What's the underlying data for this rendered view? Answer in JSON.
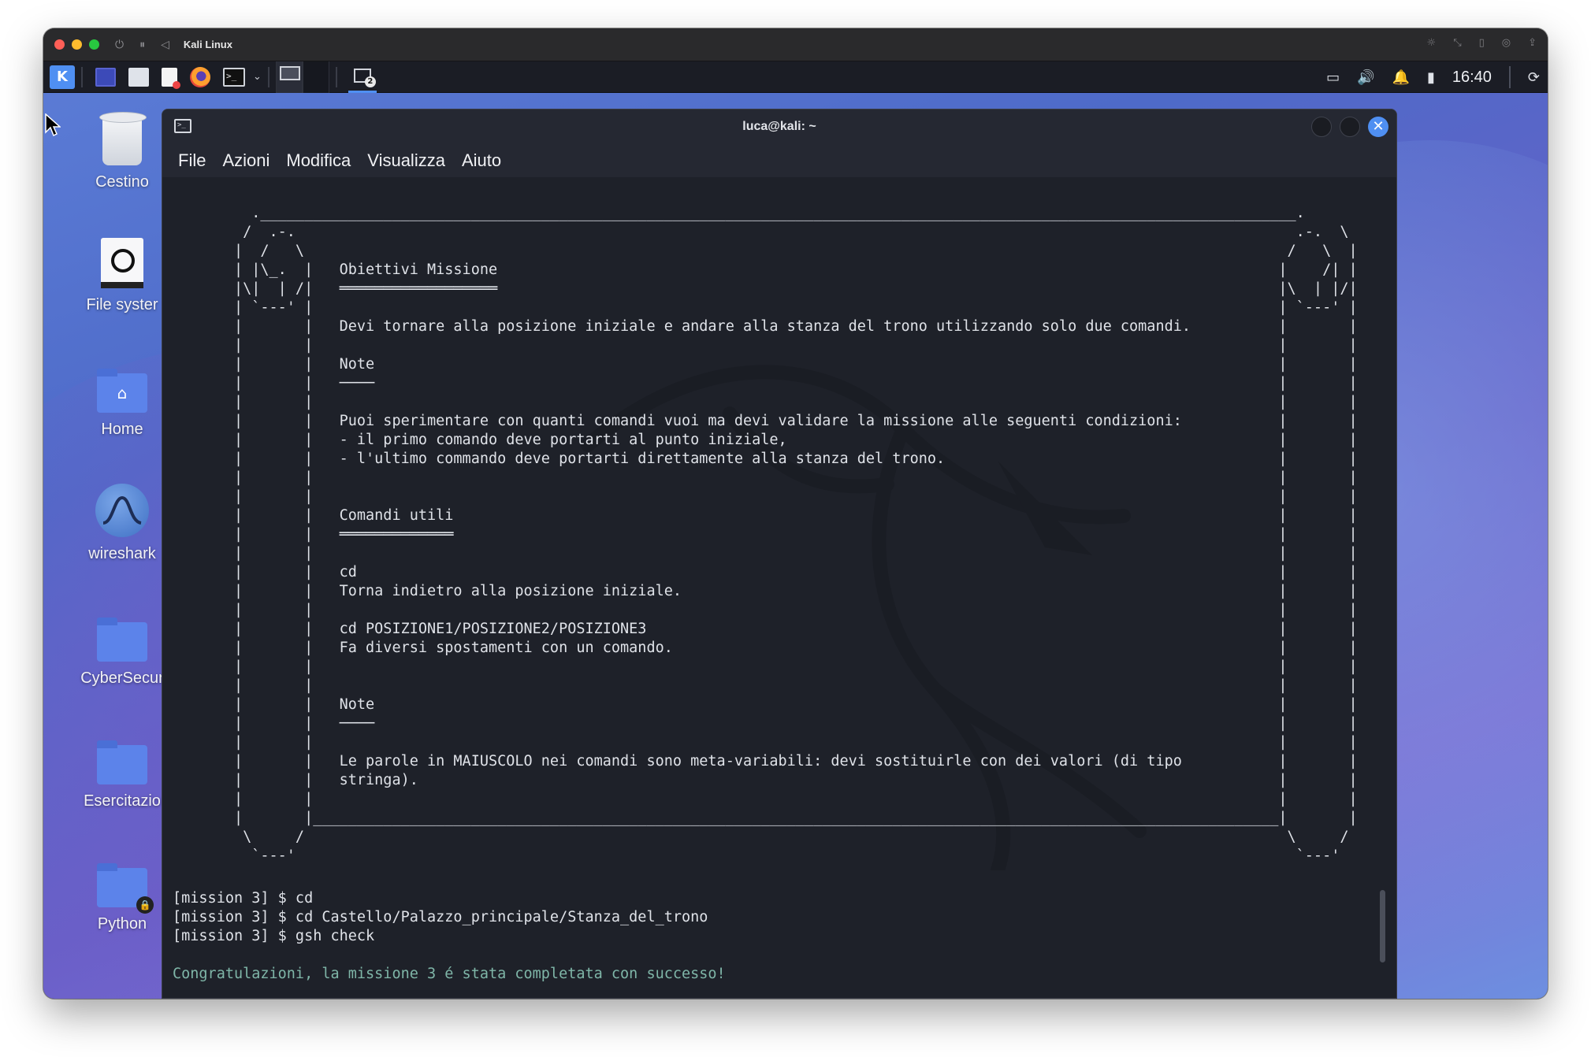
{
  "vm": {
    "title": "Kali Linux"
  },
  "taskbar": {
    "clock": "16:40",
    "apps": [
      "kali-menu",
      "show-desktop",
      "file-manager",
      "text-editor",
      "firefox",
      "terminal"
    ],
    "workspaces": 2
  },
  "desktop": {
    "icons": [
      {
        "label": "Cestino"
      },
      {
        "label": "File syster"
      },
      {
        "label": "Home"
      },
      {
        "label": "wireshark"
      },
      {
        "label": "CyberSecur"
      },
      {
        "label": "Esercitazio"
      },
      {
        "label": "Python"
      }
    ]
  },
  "terminal": {
    "title": "luca@kali: ~",
    "menu": [
      "File",
      "Azioni",
      "Modifica",
      "Visualizza",
      "Aiuto"
    ],
    "scroll_art": "         .______________________________________________________________________________________________________________________.\n        /  .-.                                                                                                                  .-.  \\\n       |  /   \\                                                                                                                /   \\  |\n       | |\\_.  |   Obiettivi Missione                                                                                         |    /| |\n       |\\|  | /|   ══════════════════                                                                                         |\\  | |/|\n       | `---' |                                                                                                              | `---' |\n       |       |   Devi tornare alla posizione iniziale e andare alla stanza del trono utilizzando solo due comandi.          |       |\n       |       |                                                                                                              |       |\n       |       |   Note                                                                                                       |       |\n       |       |   ────                                                                                                       |       |\n       |       |                                                                                                              |       |\n       |       |   Puoi sperimentare con quanti comandi vuoi ma devi validare la missione alle seguenti condizioni:           |       |\n       |       |   - il primo comando deve portarti al punto iniziale,                                                        |       |\n       |       |   - l'ultimo commando deve portarti direttamente alla stanza del trono.                                      |       |\n       |       |                                                                                                              |       |\n       |       |                                                                                                              |       |\n       |       |   Comandi utili                                                                                              |       |\n       |       |   ═════════════                                                                                              |       |\n       |       |                                                                                                              |       |\n       |       |   cd                                                                                                         |       |\n       |       |   Torna indietro alla posizione iniziale.                                                                    |       |\n       |       |                                                                                                              |       |\n       |       |   cd POSIZIONE1/POSIZIONE2/POSIZIONE3                                                                        |       |\n       |       |   Fa diversi spostamenti con un comando.                                                                     |       |\n       |       |                                                                                                              |       |\n       |       |                                                                                                              |       |\n       |       |   Note                                                                                                       |       |\n       |       |   ────                                                                                                       |       |\n       |       |                                                                                                              |       |\n       |       |   Le parole in MAIUSCOLO nei comandi sono meta-variabili: devi sostituirle con dei valori (di tipo           |       |\n       |       |   stringa).                                                                                                  |       |\n       |       |                                                                                                              |       |\n       |       |______________________________________________________________________________________________________________|       |\n        \\     /                                                                                                                \\     /\n         `---'                                                                                                                  `---'",
    "commands": [
      "[mission 3] $ cd",
      "[mission 3] $ cd Castello/Palazzo_principale/Stanza_del_trono",
      "[mission 3] $ gsh check"
    ],
    "success": "Congratulazioni, la missione 3 é stata completata con successo!"
  }
}
